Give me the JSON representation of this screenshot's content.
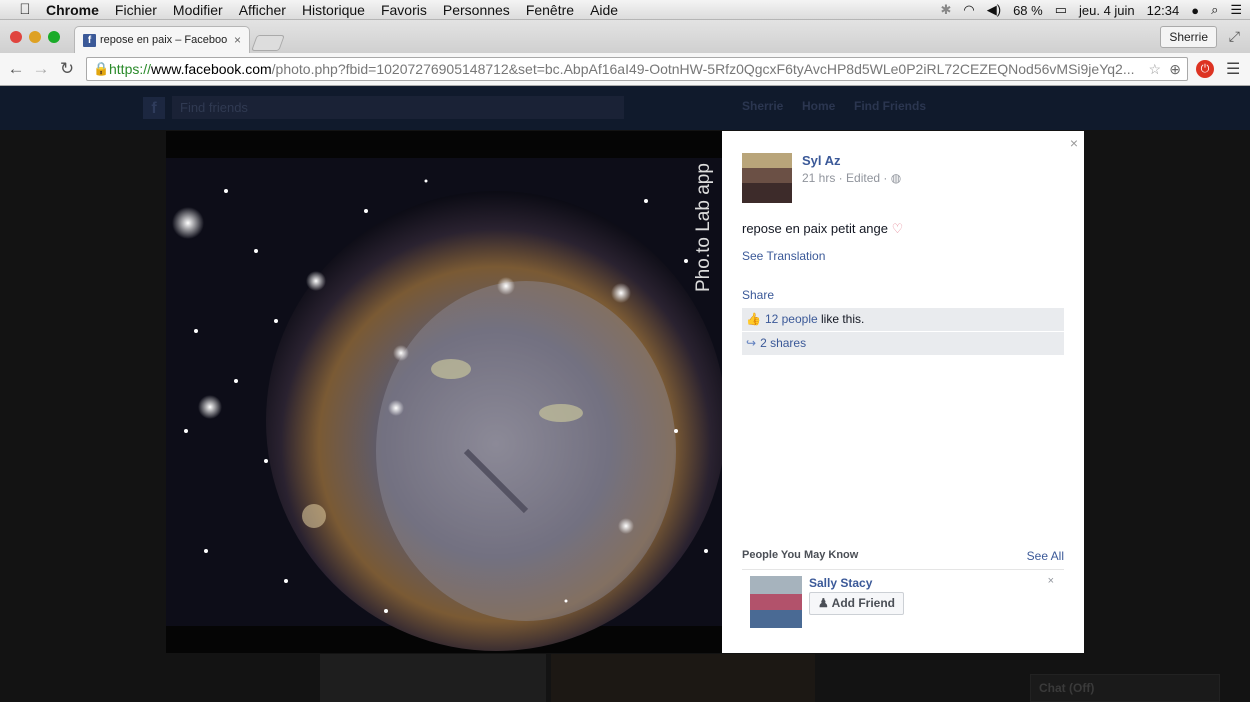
{
  "menubar": {
    "apple": "",
    "app": "Chrome",
    "items": [
      "Fichier",
      "Modifier",
      "Afficher",
      "Historique",
      "Favoris",
      "Personnes",
      "Fenêtre",
      "Aide"
    ],
    "battery": "68 %",
    "date": "jeu. 4 juin",
    "time": "12:34"
  },
  "browser": {
    "tab_title": "repose en paix – Facebook",
    "tab_close": "×",
    "profile": "Sherrie",
    "url_protocol": "https://",
    "url_host": "www.facebook.com",
    "url_path": "/photo.php?fbid=10207276905148712&set=bc.AbpAf16aI49-OotnHW-5Rfz0QgcxF6tyAvcHP8d5WLe0P2iRL72CEZEQNod56vMSi9jeYq2..."
  },
  "facebook_bar": {
    "search_placeholder": "Find friends",
    "user": "Sherrie",
    "home": "Home",
    "find_friends": "Find Friends"
  },
  "photo": {
    "watermark": "Pho.to Lab app"
  },
  "post": {
    "author": "Syl Az",
    "meta": "21 hrs · Edited ·",
    "caption": "repose en paix petit ange",
    "caption_emoji": "♡",
    "see_translation": "See Translation",
    "share": "Share",
    "likes_link": "12 people",
    "likes_text": " like this.",
    "shares": "2 shares",
    "close": "×"
  },
  "pymk": {
    "title": "People You May Know",
    "see_all": "See All",
    "person_name": "Sally Stacy",
    "add_friend": "Add Friend",
    "dismiss": "×"
  },
  "chat": {
    "label": "Chat (Off)"
  }
}
